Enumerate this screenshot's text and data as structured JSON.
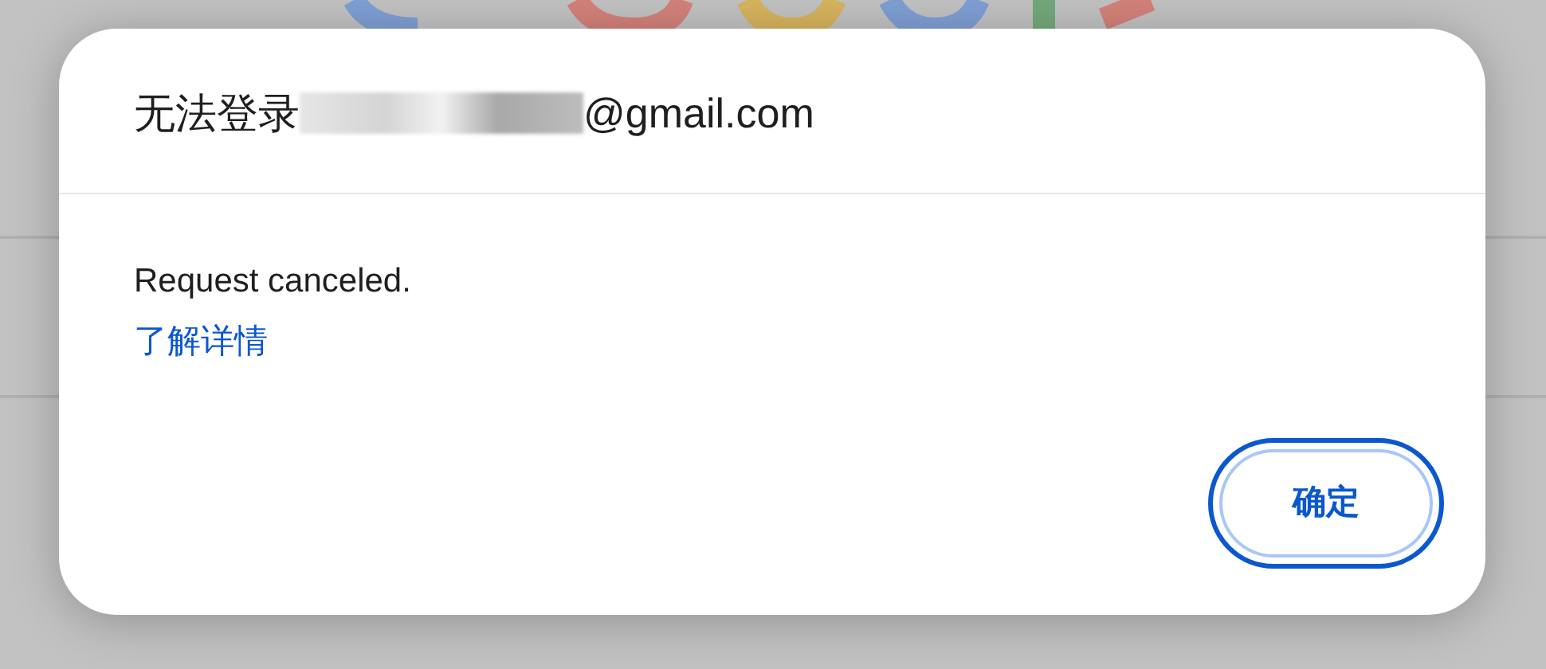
{
  "dialog": {
    "title": {
      "prefix": "无法登录",
      "redacted": true,
      "suffix": "@gmail.com"
    },
    "message": "Request canceled.",
    "link": "了解详情",
    "buttons": [
      {
        "label": "确定",
        "focused": true
      }
    ]
  }
}
